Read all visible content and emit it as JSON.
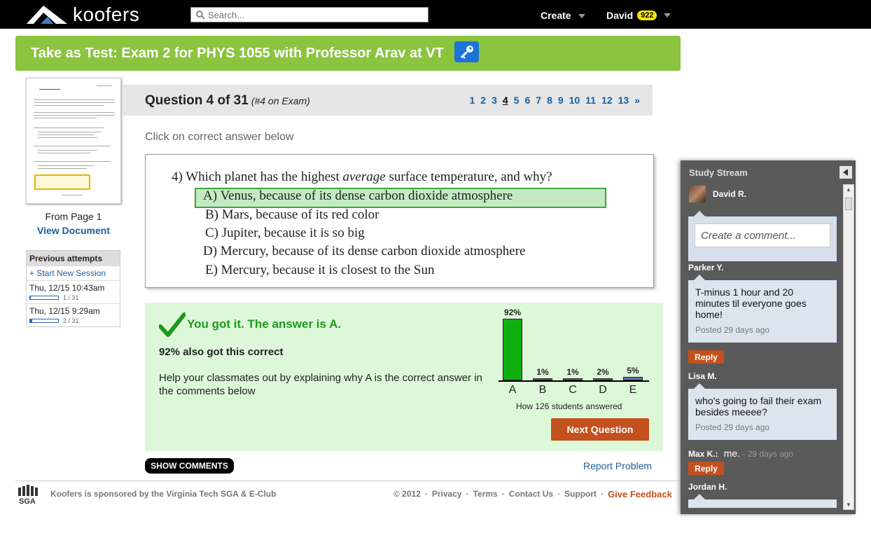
{
  "header": {
    "logo_text": "koofers",
    "search_placeholder": "Search...",
    "create_label": "Create",
    "user_name": "David",
    "user_badge": "922"
  },
  "banner": {
    "title": "Take as Test: Exam 2 for PHYS 1055 with Professor Arav at VT"
  },
  "document": {
    "from_page": "From Page 1",
    "view_label": "View Document"
  },
  "attempts": {
    "title": "Previous attempts",
    "new_session": "+ Start New Session",
    "items": [
      {
        "date": "Thu, 12/15 10:43am",
        "progress": "1 / 31",
        "fraction": 0.0323
      },
      {
        "date": "Thu, 12/15 9:29am",
        "progress": "2 / 31",
        "fraction": 0.0645
      }
    ]
  },
  "question": {
    "title": "Question 4 of 31",
    "subtitle": "(#4 on Exam)",
    "pages": [
      "1",
      "2",
      "3",
      "4",
      "5",
      "6",
      "7",
      "8",
      "9",
      "10",
      "11",
      "12",
      "13",
      "»"
    ],
    "current_page": "4",
    "instruction": "Click on correct answer below",
    "text_prefix": "4) Which planet has the highest ",
    "text_em": "average",
    "text_suffix": " surface temperature, and why?",
    "options": [
      "A) Venus, because of its dense carbon dioxide atmosphere",
      "B) Mars, because of its red color",
      "C) Jupiter, because it is so big",
      "D) Mercury, because of its dense carbon dioxide atmosphere",
      "E) Mercury, because it is closest to the Sun"
    ]
  },
  "result": {
    "title": "You got it. The answer is A.",
    "percent_text": "92% also got this correct",
    "help_text": "Help your classmates out by explaining why A is the correct answer in the comments below",
    "caption": "How 126 students answered",
    "next_label": "Next Question"
  },
  "chart_data": {
    "type": "bar",
    "categories": [
      "A",
      "B",
      "C",
      "D",
      "E"
    ],
    "values": [
      92,
      1,
      1,
      2,
      5
    ],
    "data_labels": [
      "92%",
      "1%",
      "1%",
      "2%",
      "5%"
    ],
    "colors": [
      "#11b011",
      "#11b011",
      "#11b011",
      "#11b011",
      "#5e78a8"
    ],
    "ylim": [
      0,
      92
    ]
  },
  "actions": {
    "show_comments": "SHOW COMMENTS",
    "report_problem": "Report Problem"
  },
  "footer": {
    "sponsor": "Koofers is sponsored by the Virginia Tech SGA & E-Club",
    "copyright": "© 2012",
    "links": [
      "Privacy",
      "Terms",
      "Contact Us",
      "Support"
    ],
    "feedback": "Give Feedback",
    "sga_logo": "SGA"
  },
  "stream": {
    "title": "Study Stream",
    "current_user": "David R.",
    "comment_placeholder": "Create a comment...",
    "posts": [
      {
        "author": "Parker Y.",
        "text": "T-minus 1 hour and 20 minutes til everyone goes home!",
        "posted": "Posted 29 days ago",
        "reply": "Reply"
      },
      {
        "author": "Lisa M.",
        "text": "who's going to fail their exam besides meeee?",
        "posted": "Posted 29 days ago"
      }
    ],
    "inline": {
      "author": "Max K.:",
      "text": "me.",
      "ago": "- 29 days ago",
      "reply": "Reply"
    },
    "last_author": "Jordan H."
  }
}
